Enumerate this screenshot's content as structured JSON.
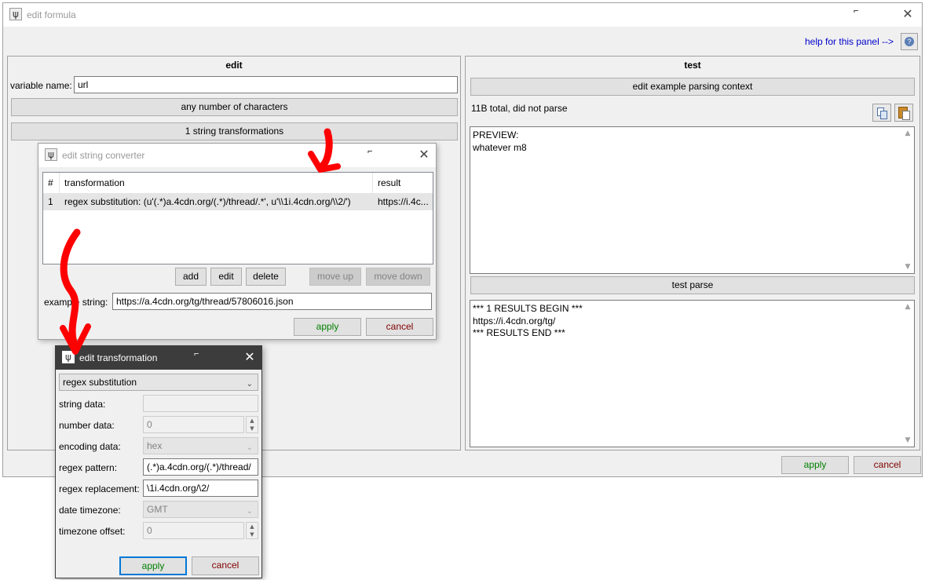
{
  "main_window": {
    "title": "edit formula",
    "help_link": "help for this panel -->",
    "edit_panel": {
      "title": "edit",
      "variable_label": "variable name:",
      "variable_value": "url",
      "char_button": "any number of characters",
      "transform_button": "1 string transformations"
    },
    "test_panel": {
      "title": "test",
      "context_button": "edit example parsing context",
      "status": "11B total, did not parse",
      "preview_line1": "PREVIEW:",
      "preview_line2": "whatever m8",
      "test_parse_button": "test parse",
      "results_line1": "*** 1 RESULTS BEGIN ***",
      "results_line2": "https://i.4cdn.org/tg/",
      "results_line3": "*** RESULTS END ***"
    },
    "apply": "apply",
    "cancel": "cancel"
  },
  "string_converter": {
    "title": "edit string converter",
    "columns": [
      "#",
      "transformation",
      "result"
    ],
    "rows": [
      {
        "num": "1",
        "transformation": "regex substitution: (u'(.*)a.4cdn.org/(.*)/thread/.*', u'\\\\1i.4cdn.org/\\\\2/')",
        "result": "https://i.4c..."
      }
    ],
    "add": "add",
    "edit": "edit",
    "delete": "delete",
    "move_up": "move up",
    "move_down": "move down",
    "example_label": "example string:",
    "example_value": "https://a.4cdn.org/tg/thread/57806016.json",
    "apply": "apply",
    "cancel": "cancel"
  },
  "edit_transformation": {
    "title": "edit transformation",
    "type_value": "regex substitution",
    "string_data_label": "string data:",
    "string_data_value": "",
    "number_data_label": "number data:",
    "number_data_value": "0",
    "encoding_label": "encoding data:",
    "encoding_value": "hex",
    "pattern_label": "regex pattern:",
    "pattern_value": "(.*)a.4cdn.org/(.*)/thread/",
    "replacement_label": "regex replacement:",
    "replacement_value": "\\1i.4cdn.org/\\2/",
    "timezone_label": "date timezone:",
    "timezone_value": "GMT",
    "offset_label": "timezone offset:",
    "offset_value": "0",
    "apply": "apply",
    "cancel": "cancel"
  },
  "icons": [
    "psi-icon",
    "close-icon",
    "help-icon",
    "copy-icon",
    "paste-icon",
    "chevron-down-icon",
    "spin-up-icon",
    "spin-down-icon"
  ],
  "colors": {
    "window_bg": "#f0f0f0",
    "button_bg": "#e1e1e1",
    "apply_green": "#008000",
    "cancel_red": "#800000",
    "link_blue": "#0000cc",
    "dark_titlebar": "#3c3c3c",
    "annotation_red": "#ff0000"
  }
}
